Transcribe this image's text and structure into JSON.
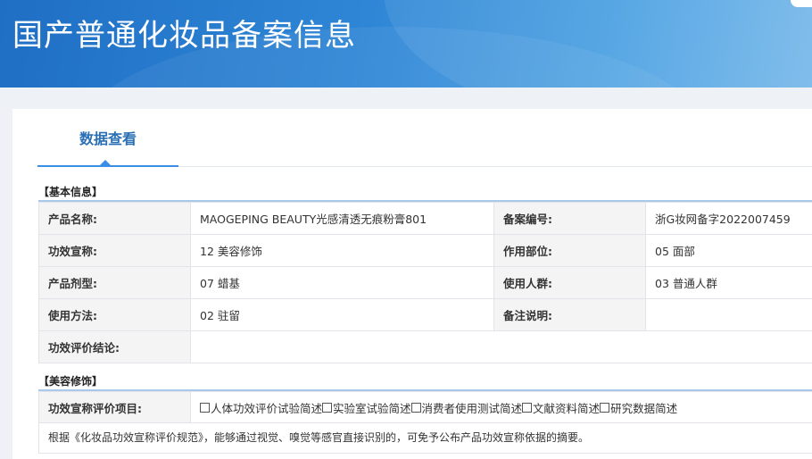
{
  "header": {
    "title": "国产普通化妆品备案信息"
  },
  "tabs": [
    {
      "label": "数据查看"
    }
  ],
  "basic_info": {
    "section_title": "【基本信息】",
    "rows": [
      {
        "label1": "产品名称:",
        "value1": "MAOGEPING BEAUTY光感清透无痕粉膏801",
        "label2": "备案编号:",
        "value2": "浙G妆网备字2022007459"
      },
      {
        "label1": "功效宣称:",
        "value1": "12 美容修饰",
        "label2": "作用部位:",
        "value2": "05 面部"
      },
      {
        "label1": "产品剂型:",
        "value1": "07 蜡基",
        "label2": "使用人群:",
        "value2": "03 普通人群"
      },
      {
        "label1": "使用方法:",
        "value1": "02 驻留",
        "label2": "备注说明:",
        "value2": ""
      }
    ],
    "conclusion_label": "功效评价结论:",
    "conclusion_value": ""
  },
  "beauty": {
    "section_title": "【美容修饰】",
    "claims_label": "功效宣称评价项目:",
    "options": [
      "人体功效评价试验简述",
      "实验室试验简述",
      "消费者使用测试简述",
      "文献资料简述",
      "研究数据简述"
    ],
    "note": "根据《化妆品功效宣称评价规范》，能够通过视觉、嗅觉等感官直接识别的，可免予公布产品功效宣称依据的摘要。"
  }
}
